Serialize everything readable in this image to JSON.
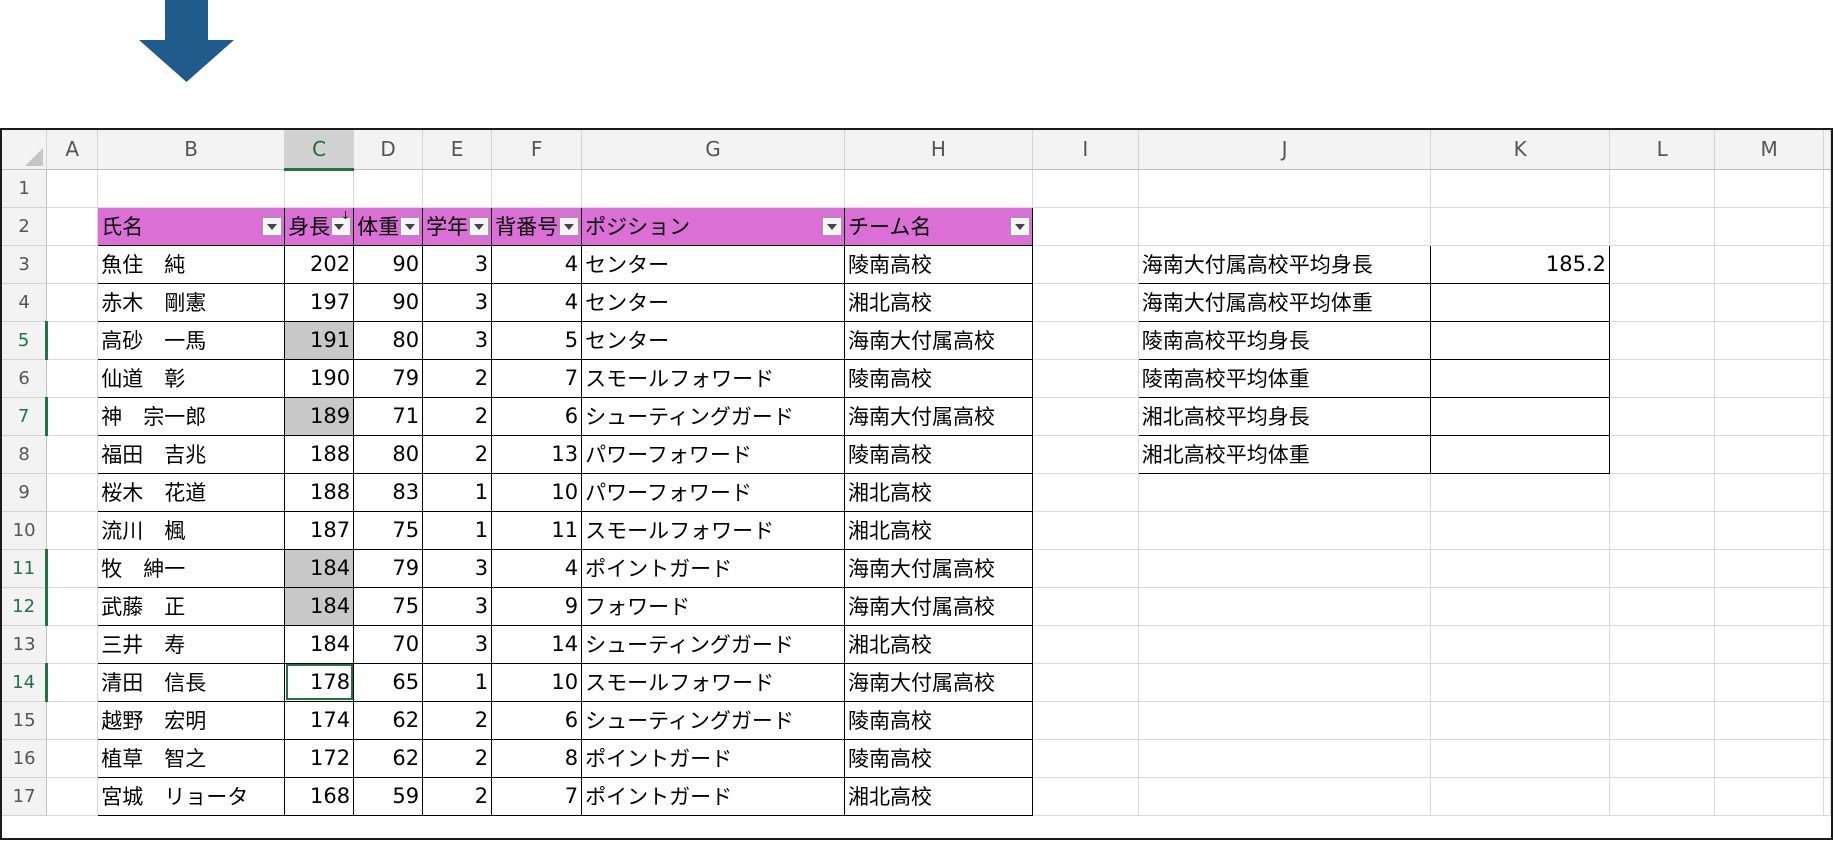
{
  "columns": [
    "A",
    "B",
    "C",
    "D",
    "E",
    "F",
    "G",
    "H",
    "I",
    "J",
    "K",
    "L",
    "M"
  ],
  "selected_column": "C",
  "table_headers": [
    "氏名",
    "身長",
    "体重",
    "学年",
    "背番号",
    "ポジション",
    "チーム名"
  ],
  "players": [
    {
      "name": "魚住　純",
      "height": "202",
      "weight": "90",
      "grade": "3",
      "number": "4",
      "position": "センター",
      "team": "陵南高校"
    },
    {
      "name": "赤木　剛憲",
      "height": "197",
      "weight": "90",
      "grade": "3",
      "number": "4",
      "position": "センター",
      "team": "湘北高校"
    },
    {
      "name": "高砂　一馬",
      "height": "191",
      "weight": "80",
      "grade": "3",
      "number": "5",
      "position": "センター",
      "team": "海南大付属高校"
    },
    {
      "name": "仙道　彰",
      "height": "190",
      "weight": "79",
      "grade": "2",
      "number": "7",
      "position": "スモールフォワード",
      "team": "陵南高校"
    },
    {
      "name": "神　宗一郎",
      "height": "189",
      "weight": "71",
      "grade": "2",
      "number": "6",
      "position": "シューティングガード",
      "team": "海南大付属高校"
    },
    {
      "name": "福田　吉兆",
      "height": "188",
      "weight": "80",
      "grade": "2",
      "number": "13",
      "position": "パワーフォワード",
      "team": "陵南高校"
    },
    {
      "name": "桜木　花道",
      "height": "188",
      "weight": "83",
      "grade": "1",
      "number": "10",
      "position": "パワーフォワード",
      "team": "湘北高校"
    },
    {
      "name": "流川　楓",
      "height": "187",
      "weight": "75",
      "grade": "1",
      "number": "11",
      "position": "スモールフォワード",
      "team": "湘北高校"
    },
    {
      "name": "牧　紳一",
      "height": "184",
      "weight": "79",
      "grade": "3",
      "number": "4",
      "position": "ポイントガード",
      "team": "海南大付属高校"
    },
    {
      "name": "武藤　正",
      "height": "184",
      "weight": "75",
      "grade": "3",
      "number": "9",
      "position": "フォワード",
      "team": "海南大付属高校"
    },
    {
      "name": "三井　寿",
      "height": "184",
      "weight": "70",
      "grade": "3",
      "number": "14",
      "position": "シューティングガード",
      "team": "湘北高校"
    },
    {
      "name": "清田　信長",
      "height": "178",
      "weight": "65",
      "grade": "1",
      "number": "10",
      "position": "スモールフォワード",
      "team": "海南大付属高校"
    },
    {
      "name": "越野　宏明",
      "height": "174",
      "weight": "62",
      "grade": "2",
      "number": "6",
      "position": "シューティングガード",
      "team": "陵南高校"
    },
    {
      "name": "植草　智之",
      "height": "172",
      "weight": "62",
      "grade": "2",
      "number": "8",
      "position": "ポイントガード",
      "team": "陵南高校"
    },
    {
      "name": "宮城　リョータ",
      "height": "168",
      "weight": "59",
      "grade": "2",
      "number": "7",
      "position": "ポイントガード",
      "team": "湘北高校"
    }
  ],
  "summary": [
    {
      "label": "海南大付属高校平均身長",
      "value": "185.2"
    },
    {
      "label": "海南大付属高校平均体重",
      "value": ""
    },
    {
      "label": "陵南高校平均身長",
      "value": ""
    },
    {
      "label": "陵南高校平均体重",
      "value": ""
    },
    {
      "label": "湘北高校平均身長",
      "value": ""
    },
    {
      "label": "湘北高校平均体重",
      "value": ""
    }
  ],
  "colors": {
    "header_fill": "#da70d6",
    "selection_green": "#217346",
    "highlight_gray": "#c8c8c8",
    "arrow": "#1f5c8b"
  },
  "icons": {
    "arrow": "down-arrow-icon",
    "filter": "filter-dropdown-icon",
    "sort": "sort-descending-icon"
  }
}
